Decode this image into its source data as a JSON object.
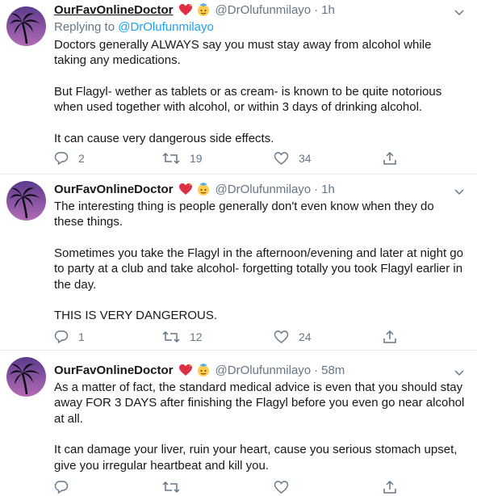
{
  "tweets": [
    {
      "name": "OurFavOnlineDoctor",
      "handle": "@DrOlufunmilayo",
      "time": "1h",
      "reply_prefix": "Replying to",
      "reply_to": "@DrOlufunmilayo",
      "paragraphs": [
        "Doctors generally ALWAYS say you must stay away from alcohol while taking any medications.",
        "But Flagyl- wether as tablets or as cream- is known to be quite notorious when used together with alcohol, or within 3 days of drinking alcohol.",
        "It can cause very dangerous side effects."
      ],
      "replies": "2",
      "retweets": "19",
      "likes": "34"
    },
    {
      "name": "OurFavOnlineDoctor",
      "handle": "@DrOlufunmilayo",
      "time": "1h",
      "paragraphs": [
        "The interesting thing is people generally don't even know when they do these things.",
        "Sometimes you take the Flagyl in the afternoon/evening and later at night go to party at a club and take alcohol- forgetting totally you took Flagyl earlier in the day.",
        "THIS IS VERY DANGEROUS."
      ],
      "replies": "1",
      "retweets": "12",
      "likes": "24"
    },
    {
      "name": "OurFavOnlineDoctor",
      "handle": "@DrOlufunmilayo",
      "time": "58m",
      "paragraphs": [
        "As a matter of fact, the standard medical advice is even that you should stay away FOR 3 DAYS after finishing the Flagyl before you even go near alcohol at all.",
        "It can damage your liver, ruin your heart, cause you serious stomach upset, give you irregular heartbeat and kill you."
      ]
    }
  ],
  "icons": {
    "reply": "comment-icon",
    "retweet": "retweet-icon",
    "like": "heart-icon",
    "share": "share-icon",
    "more": "chevron-down-icon"
  },
  "colors": {
    "link": "#1da1f2",
    "secondary_text": "#657786",
    "separator": "#e6ecf0",
    "avatar_bg": "#7a4fa8"
  }
}
